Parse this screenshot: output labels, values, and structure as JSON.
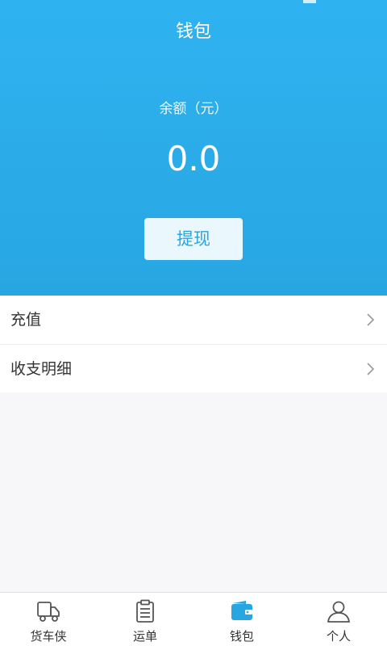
{
  "header": {
    "title": "钱包",
    "balance_label": "余额（元）",
    "balance_value": "0.0",
    "withdraw_label": "提现"
  },
  "menu": {
    "items": [
      {
        "label": "充值",
        "icon": "chevron-right-icon"
      },
      {
        "label": "收支明细",
        "icon": "chevron-right-icon"
      }
    ]
  },
  "tabbar": {
    "tabs": [
      {
        "label": "货车侠",
        "icon": "truck-icon",
        "active": false
      },
      {
        "label": "运单",
        "icon": "clipboard-icon",
        "active": false
      },
      {
        "label": "钱包",
        "icon": "wallet-icon",
        "active": true
      },
      {
        "label": "个人",
        "icon": "person-icon",
        "active": false
      }
    ]
  },
  "colors": {
    "header_bg": "#2fb3f0",
    "accent": "#27a6e2",
    "button_bg": "#eaf7fd",
    "icon_gray": "#555555"
  }
}
